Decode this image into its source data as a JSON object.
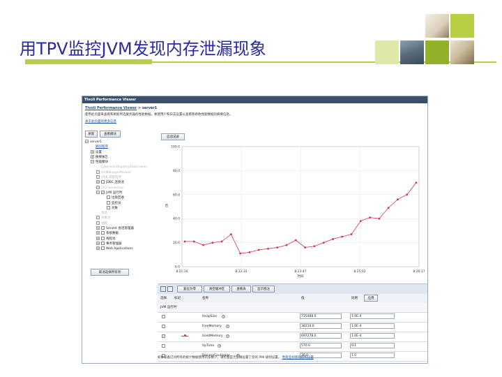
{
  "slide": {
    "title": "用TPV监控JVM发现内存泄漏现象"
  },
  "window": {
    "title": "Tivoli Performance Viewer",
    "breadcrumb_link": "Tivoli Performance Viewer",
    "breadcrumb_tail": " > server1",
    "description": "使用此页面来查看和刷新所选服务器的性能数据。要使用户和日志设置以查看和修改性能数据的摘要信息。",
    "more_info_link": "关于此页面的更多信息"
  },
  "left_panel": {
    "refresh_button": "刷新",
    "view_module_button": "查看模块",
    "tree": [
      {
        "label": "server1",
        "level": 0,
        "exp": "−",
        "checkbox": false,
        "dim": false
      },
      {
        "label": "顾问程序",
        "level": 1,
        "exp": "",
        "checkbox": false,
        "dim": false,
        "link": true
      },
      {
        "label": "设置",
        "level": 1,
        "exp": "+",
        "checkbox": false,
        "dim": false
      },
      {
        "label": "摘要报告",
        "level": 1,
        "exp": "+",
        "checkbox": false,
        "dim": false
      },
      {
        "label": "性能模块",
        "level": 1,
        "exp": "−",
        "checkbox": false,
        "dim": false
      },
      {
        "label": "ExtensionRegistryStats.name",
        "level": 2,
        "exp": "",
        "checkbox": false,
        "dim": true
      },
      {
        "label": "HAManagerModule",
        "level": 2,
        "exp": "+",
        "checkbox": false,
        "dim": true
      },
      {
        "label": "ORB 调度程序",
        "level": 2,
        "exp": "+",
        "checkbox": false,
        "dim": true
      },
      {
        "label": "JDBC 连接池",
        "level": 2,
        "exp": "+",
        "checkbox": true,
        "dim": false
      },
      {
        "label": "J2CConnection",
        "level": 2,
        "exp": "+",
        "checkbox": false,
        "dim": true
      },
      {
        "label": "JVM 运行时",
        "level": 2,
        "exp": "−",
        "checkbox": true,
        "checked": true,
        "dim": false
      },
      {
        "label": "垃圾回收",
        "level": 3,
        "exp": "",
        "checkbox": true,
        "dim": false
      },
      {
        "label": "监控员",
        "level": 3,
        "exp": "",
        "checkbox": true,
        "dim": false
      },
      {
        "label": "对象",
        "level": 3,
        "exp": "",
        "checkbox": true,
        "dim": false
      },
      {
        "label": "会话",
        "level": 2,
        "exp": "",
        "checkbox": false,
        "dim": true
      },
      {
        "label": "对象池",
        "level": 2,
        "exp": "+",
        "checkbox": false,
        "dim": true
      },
      {
        "label": "线程",
        "level": 2,
        "exp": "+",
        "checkbox": false,
        "dim": true
      },
      {
        "label": "Servlet 会话管理器",
        "level": 2,
        "exp": "+",
        "checkbox": true,
        "dim": false
      },
      {
        "label": "系统数据",
        "level": 2,
        "exp": "+",
        "checkbox": true,
        "dim": false
      },
      {
        "label": "线程池",
        "level": 2,
        "exp": "+",
        "checkbox": true,
        "dim": false
      },
      {
        "label": "事务管理器",
        "level": 2,
        "exp": "+",
        "checkbox": true,
        "dim": false
      },
      {
        "label": "Web Applications",
        "level": 2,
        "exp": "+",
        "checkbox": true,
        "dim": false
      }
    ],
    "clear_button": "取消选择所有项"
  },
  "chart_toolbar": {
    "log_button": "启动记录"
  },
  "chart_data": {
    "type": "line",
    "ylim": [
      0,
      100
    ],
    "yticks": [
      "100.0",
      "80.0",
      "60.0",
      "40.0",
      "20.0",
      "0.0"
    ],
    "ylabel": "百",
    "xticks": [
      "8:21:16",
      "8:22:32",
      "8:23:47",
      "8:25:02",
      "8:26:17"
    ],
    "xlabel": "时间",
    "series": [
      {
        "color": "#d9344a",
        "values": [
          21,
          21,
          18,
          20,
          21,
          27,
          11,
          12,
          14,
          15,
          16,
          18,
          22,
          16,
          17,
          20,
          23,
          25,
          27,
          38,
          41,
          40,
          49,
          56,
          60,
          70
        ]
      }
    ]
  },
  "table_toolbar": {
    "reset_button": "复位为零",
    "clear_buffer_button": "清空缓冲区",
    "view_table_button": "查看表",
    "show_legend_button": "显示图注"
  },
  "table": {
    "headers": {
      "select": "选择",
      "marker": "标记",
      "name": "名称",
      "value": "值",
      "scale": "比例"
    },
    "apply_button": "应用",
    "group": "JVM 运行时",
    "rows": [
      {
        "name": "HeapSize",
        "value": "735488.0",
        "scale": "1.0E-4",
        "checked": false,
        "marker": false
      },
      {
        "name": "FreeMemory",
        "value": "38210.0",
        "scale": "1.0E-4",
        "checked": false,
        "marker": false
      },
      {
        "name": "UsedMemory",
        "value": "697278.0",
        "scale": "1.0E-4",
        "checked": true,
        "marker": true
      },
      {
        "name": "UpTime",
        "value": "570.0",
        "scale": "0.1",
        "checked": false,
        "marker": false
      },
      {
        "name": "ProcessCpuUsage",
        "value": "26.0",
        "scale": "1.0",
        "checked": false,
        "marker": false
      }
    ]
  },
  "footer": {
    "text": "如果设备已对所有的统计数据使用的多数少，请检查是否正确设置了您的 PMI 级别设置。",
    "link": "性能监视基础结构设置"
  },
  "colors": {
    "title": "#2a2aa0",
    "accent": "#b8cf44",
    "series": "#d9344a"
  }
}
